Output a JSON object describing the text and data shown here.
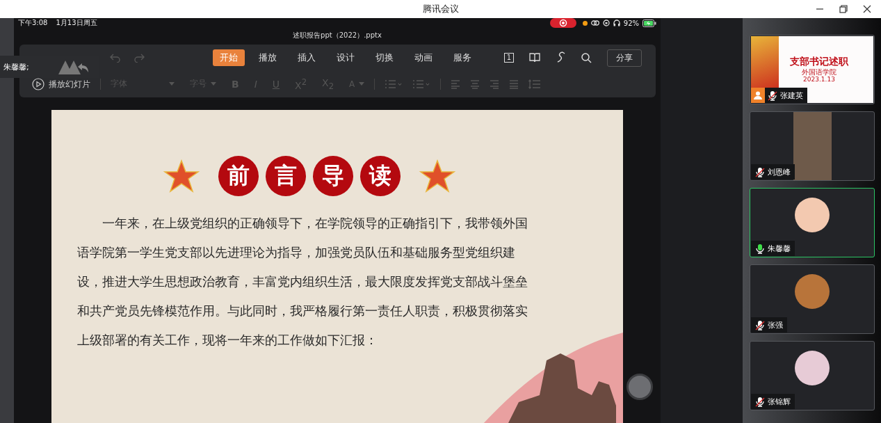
{
  "window": {
    "title": "腾讯会议"
  },
  "shared_screen": {
    "status_bar": {
      "time": "下午3:08",
      "date": "1月13日周五",
      "battery": "92%"
    },
    "document_title": "述职报告ppt（2022）.pptx",
    "tabs": [
      {
        "label": "开始",
        "selected": true
      },
      {
        "label": "播放",
        "selected": false
      },
      {
        "label": "插入",
        "selected": false
      },
      {
        "label": "设计",
        "selected": false
      },
      {
        "label": "切换",
        "selected": false
      },
      {
        "label": "动画",
        "selected": false
      },
      {
        "label": "服务",
        "selected": false
      }
    ],
    "slide_number": "1",
    "share_button": "分享",
    "play_button": "播放幻灯片",
    "format_tools": [
      {
        "kind": "dropdown",
        "label": "字体",
        "disabled": true
      },
      {
        "kind": "dropdown",
        "label": "字号",
        "disabled": true
      },
      {
        "kind": "text",
        "label": "B",
        "disabled": true
      },
      {
        "kind": "text",
        "label": "I",
        "disabled": true
      },
      {
        "kind": "text",
        "label": "U",
        "disabled": true
      },
      {
        "kind": "text",
        "label": "X$^{2}$",
        "disabled": true
      },
      {
        "kind": "text",
        "label": "X$_{2}$",
        "disabled": true
      },
      {
        "kind": "dropdown",
        "label": "A",
        "disabled": true
      }
    ],
    "slide": {
      "heading_chars": [
        "前",
        "言",
        "导",
        "读"
      ],
      "body": "一年来，在上级党组织的正确领导下，在学院领导的正确指引下，我带领外国语学院第一学生党支部以先进理论为指导，加强党员队伍和基础服务型党组织建设，推进大学生思想政治教育，丰富党内组织生活，最大限度发挥党支部战斗堡垒和共产党员先锋模范作用。与此同时，我严格履行第一责任人职责，积极贯彻落实上级部署的有关工作，现将一年来的工作做如下汇报："
    }
  },
  "speaker_label": "朱馨馨;",
  "participants": [
    {
      "name": "张建英",
      "mic_on": false,
      "speaking": false,
      "kind": "screen",
      "screen_title": "支部书记述职",
      "screen_subtitle": "外国语学院",
      "screen_date": "2023.1.13"
    },
    {
      "name": "刘恩峰",
      "mic_on": false,
      "speaking": false,
      "kind": "camera"
    },
    {
      "name": "朱馨馨",
      "mic_on": true,
      "speaking": true,
      "kind": "avatar"
    },
    {
      "name": "张强",
      "mic_on": false,
      "speaking": false,
      "kind": "avatar"
    },
    {
      "name": "张锦辉",
      "mic_on": false,
      "speaking": false,
      "kind": "avatar"
    }
  ]
}
